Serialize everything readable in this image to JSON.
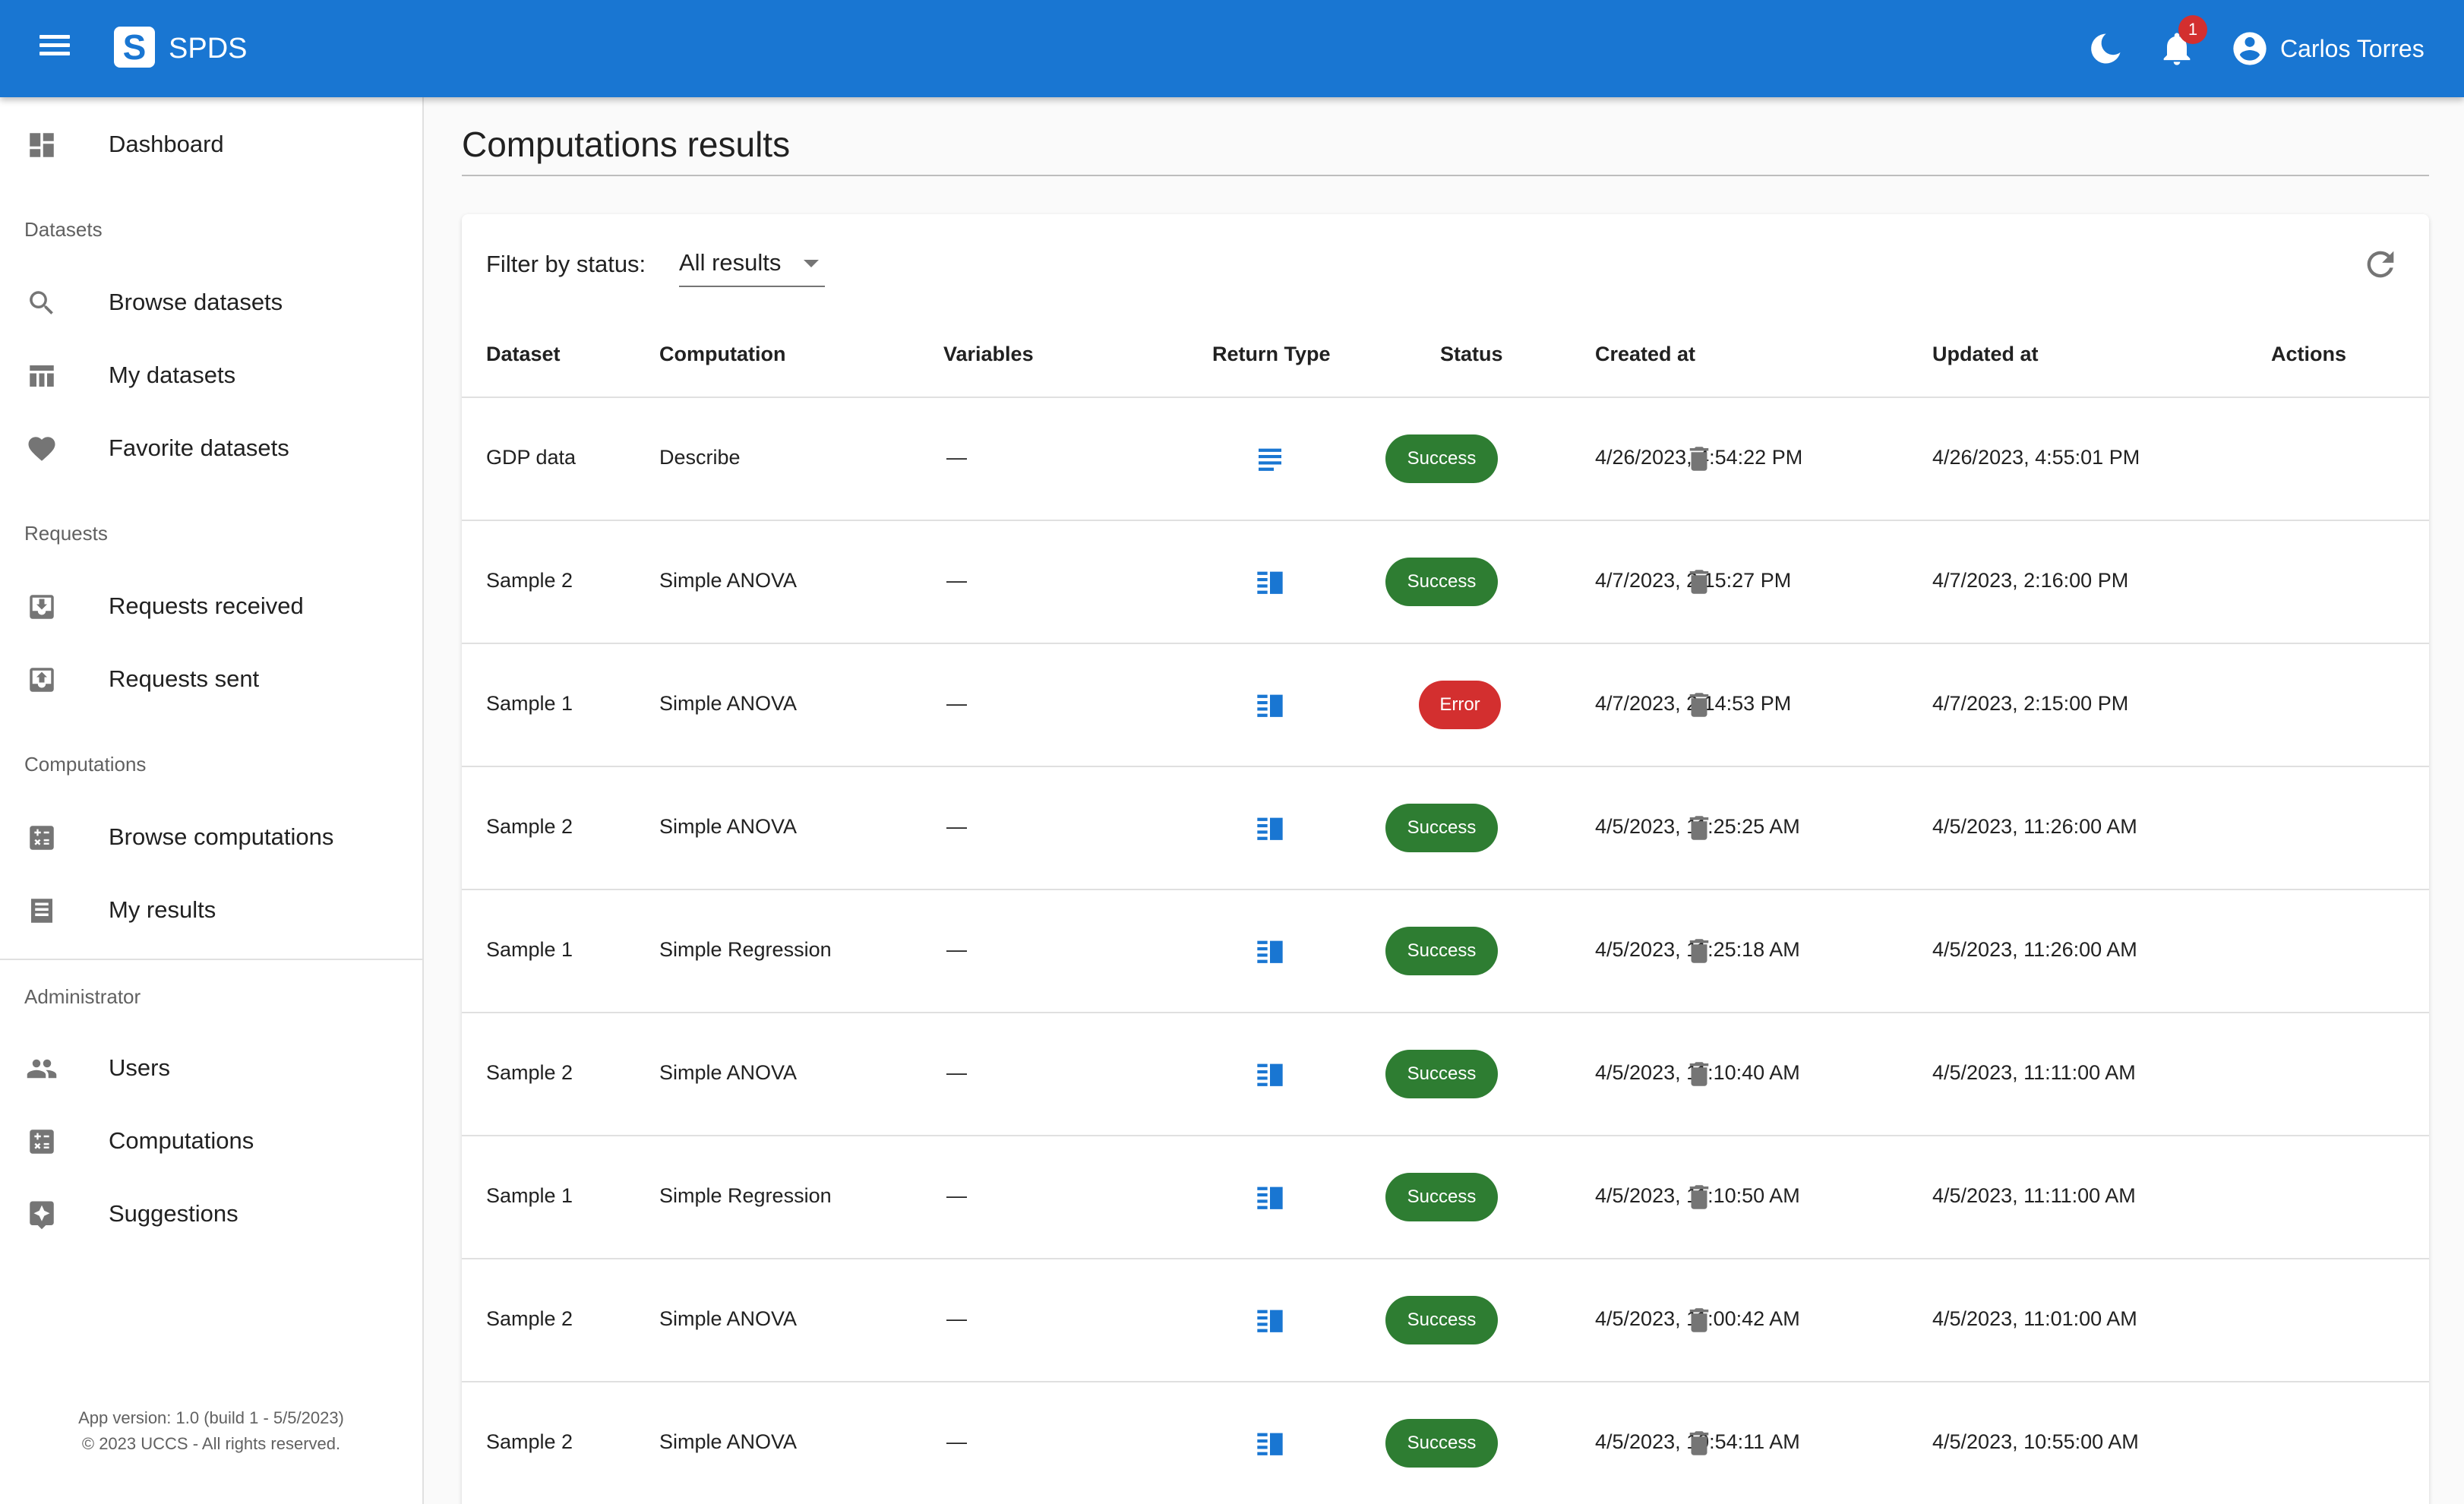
{
  "app": {
    "logo_letter": "S",
    "title": "SPDS",
    "user_name": "Carlos Torres",
    "notification_count": "1",
    "brand_color": "#1976d2"
  },
  "icons": {
    "menu": "menu-icon",
    "theme": "moon-icon",
    "notifications": "bell-icon",
    "account": "account-circle-icon",
    "refresh": "refresh-icon",
    "delete": "trash-icon"
  },
  "sidebar": {
    "dashboard": "Dashboard",
    "sections": {
      "datasets": "Datasets",
      "requests": "Requests",
      "computations": "Computations",
      "administrator": "Administrator"
    },
    "items": {
      "browse_datasets": "Browse datasets",
      "my_datasets": "My datasets",
      "favorite_datasets": "Favorite datasets",
      "requests_received": "Requests received",
      "requests_sent": "Requests sent",
      "browse_computations": "Browse computations",
      "my_results": "My results",
      "users": "Users",
      "admin_computations": "Computations",
      "suggestions": "Suggestions"
    },
    "footer": {
      "version": "App version: 1.0 (build 1 - 5/5/2023)",
      "copyright": "© 2023 UCCS - All rights reserved."
    }
  },
  "main": {
    "title": "Computations results",
    "filter_label": "Filter by status:",
    "filter_value": "All results",
    "columns": {
      "dataset": "Dataset",
      "computation": "Computation",
      "variables": "Variables",
      "return_type": "Return Type",
      "status": "Status",
      "created_at": "Created at",
      "updated_at": "Updated at",
      "actions": "Actions"
    },
    "status_colors": {
      "success": "#2e7d32",
      "error": "#d32f2f"
    },
    "rows": [
      {
        "dataset": "GDP data",
        "computation": "Describe",
        "variables": "—",
        "return_type": "text",
        "status": "Success",
        "created": "4/26/2023, 4:54:22 PM",
        "updated": "4/26/2023, 4:55:01 PM"
      },
      {
        "dataset": "Sample 2",
        "computation": "Simple ANOVA",
        "variables": "—",
        "return_type": "table",
        "status": "Success",
        "created": "4/7/2023, 2:15:27 PM",
        "updated": "4/7/2023, 2:16:00 PM"
      },
      {
        "dataset": "Sample 1",
        "computation": "Simple ANOVA",
        "variables": "—",
        "return_type": "table",
        "status": "Error",
        "created": "4/7/2023, 2:14:53 PM",
        "updated": "4/7/2023, 2:15:00 PM"
      },
      {
        "dataset": "Sample 2",
        "computation": "Simple ANOVA",
        "variables": "—",
        "return_type": "table",
        "status": "Success",
        "created": "4/5/2023, 11:25:25 AM",
        "updated": "4/5/2023, 11:26:00 AM"
      },
      {
        "dataset": "Sample 1",
        "computation": "Simple Regression",
        "variables": "—",
        "return_type": "table",
        "status": "Success",
        "created": "4/5/2023, 11:25:18 AM",
        "updated": "4/5/2023, 11:26:00 AM"
      },
      {
        "dataset": "Sample 2",
        "computation": "Simple ANOVA",
        "variables": "—",
        "return_type": "table",
        "status": "Success",
        "created": "4/5/2023, 11:10:40 AM",
        "updated": "4/5/2023, 11:11:00 AM"
      },
      {
        "dataset": "Sample 1",
        "computation": "Simple Regression",
        "variables": "—",
        "return_type": "table",
        "status": "Success",
        "created": "4/5/2023, 11:10:50 AM",
        "updated": "4/5/2023, 11:11:00 AM"
      },
      {
        "dataset": "Sample 2",
        "computation": "Simple ANOVA",
        "variables": "—",
        "return_type": "table",
        "status": "Success",
        "created": "4/5/2023, 11:00:42 AM",
        "updated": "4/5/2023, 11:01:00 AM"
      },
      {
        "dataset": "Sample 2",
        "computation": "Simple ANOVA",
        "variables": "—",
        "return_type": "table",
        "status": "Success",
        "created": "4/5/2023, 10:54:11 AM",
        "updated": "4/5/2023, 10:55:00 AM"
      }
    ]
  }
}
